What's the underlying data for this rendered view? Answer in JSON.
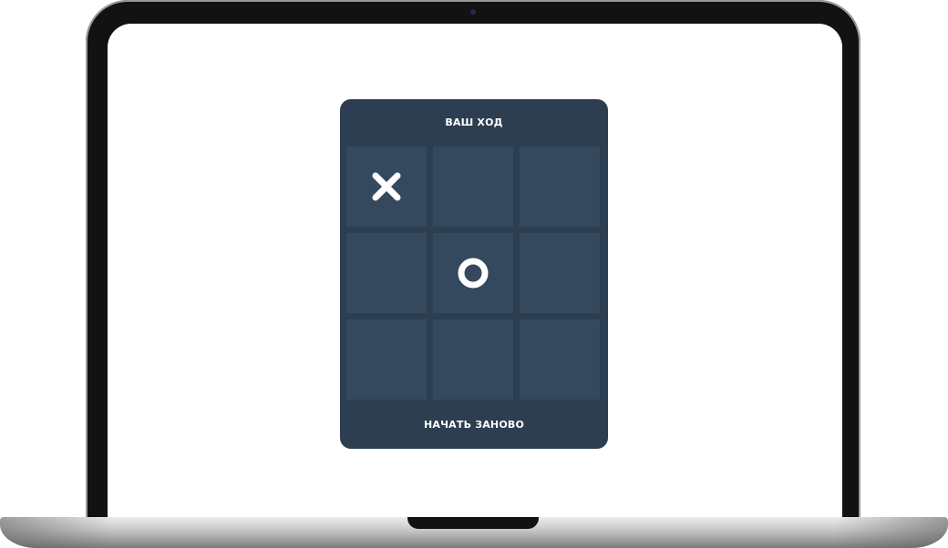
{
  "game": {
    "status_text": "ВАШ ХОД",
    "restart_label": "НАЧАТЬ ЗАНОВО",
    "board": [
      "x",
      "",
      "",
      "",
      "o",
      "",
      "",
      "",
      ""
    ]
  },
  "colors": {
    "card_bg": "#2c3e50",
    "cell_bg": "#34495e",
    "mark": "#ffffff",
    "screen_bg": "#ffffff",
    "bezel": "#121212"
  },
  "icons": {
    "x_mark": "x-mark-icon",
    "o_mark": "o-mark-icon",
    "camera": "camera-icon"
  }
}
